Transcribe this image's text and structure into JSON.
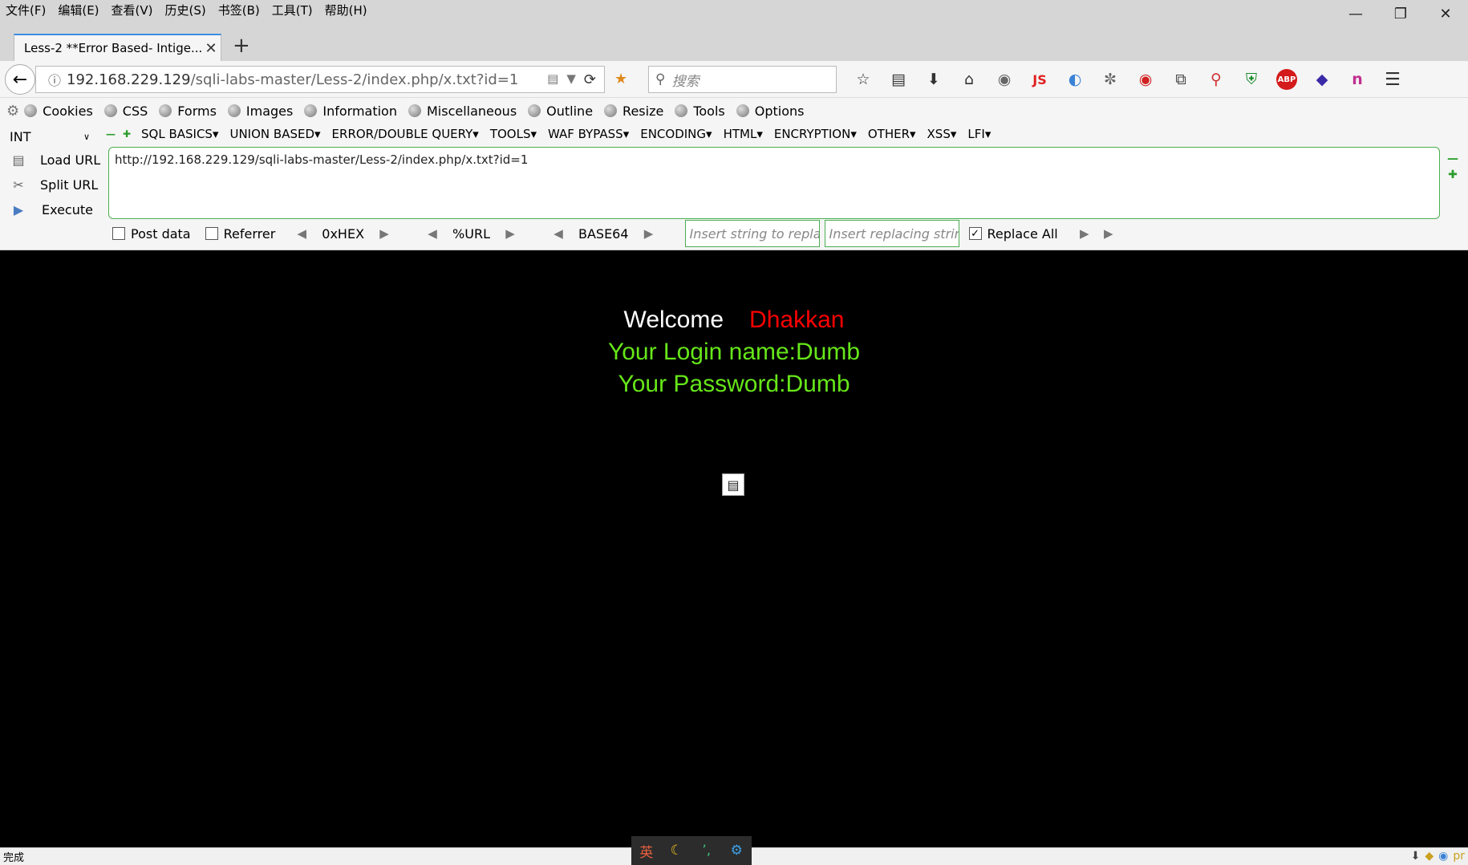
{
  "menubar": {
    "items": [
      "文件(F)",
      "编辑(E)",
      "查看(V)",
      "历史(S)",
      "书签(B)",
      "工具(T)",
      "帮助(H)"
    ],
    "window_controls": [
      "minimize-icon",
      "restore-icon",
      "close-icon"
    ]
  },
  "tab": {
    "title": "Less-2 **Error Based- Intige...",
    "close": "✕",
    "new_tab": "+"
  },
  "navbar": {
    "url_host": "192.168.229.129",
    "url_path": "/sqli-labs-master/Less-2/index.php/x.txt?id=1",
    "search_placeholder": "搜索",
    "toolbar_icons": [
      "star-icon",
      "bookmarks-list-icon",
      "download-icon",
      "home-icon",
      "globe-icon",
      "js-icon",
      "translate-icon",
      "palette-icon",
      "shield-ext-icon",
      "screenshot-icon",
      "search-ext-icon",
      "adguard-icon",
      "adblock-icon",
      "diamond-icon",
      "n-icon",
      "hamburger-menu-icon"
    ],
    "js_label": "JS",
    "abp_label": "ABP"
  },
  "devbar": {
    "items": [
      "Cookies",
      "CSS",
      "Forms",
      "Images",
      "Information",
      "Miscellaneous",
      "Outline",
      "Resize",
      "Tools",
      "Options"
    ]
  },
  "hackbar": {
    "select_value": "INT",
    "menus": [
      "SQL BASICS",
      "UNION BASED",
      "ERROR/DOUBLE QUERY",
      "TOOLS",
      "WAF BYPASS",
      "ENCODING",
      "HTML",
      "ENCRYPTION",
      "OTHER",
      "XSS",
      "LFI"
    ],
    "actions": [
      "Load URL",
      "Split URL",
      "Execute"
    ],
    "url_value": "http://192.168.229.129/sqli-labs-master/Less-2/index.php/x.txt?id=1",
    "post_data_label": "Post data",
    "referrer_label": "Referrer",
    "encoders": [
      "0xHEX",
      "%URL",
      "BASE64"
    ],
    "replace_placeholder": "Insert string to replace",
    "replacing_placeholder": "Insert replacing string",
    "replace_all_label": "Replace All",
    "replace_all_checked": true
  },
  "content": {
    "welcome": "Welcome",
    "name": "Dhakkan",
    "login_line": "Your Login name:Dumb",
    "password_line": "Your Password:Dumb",
    "colors": {
      "welcome": "#ffffff",
      "name": "#ff0000",
      "lines": "#66e619",
      "background": "#000000"
    }
  },
  "statusbar": {
    "text": "完成"
  },
  "ime": {
    "items": [
      "英",
      "☾",
      "ʼ,",
      "⚙"
    ]
  }
}
